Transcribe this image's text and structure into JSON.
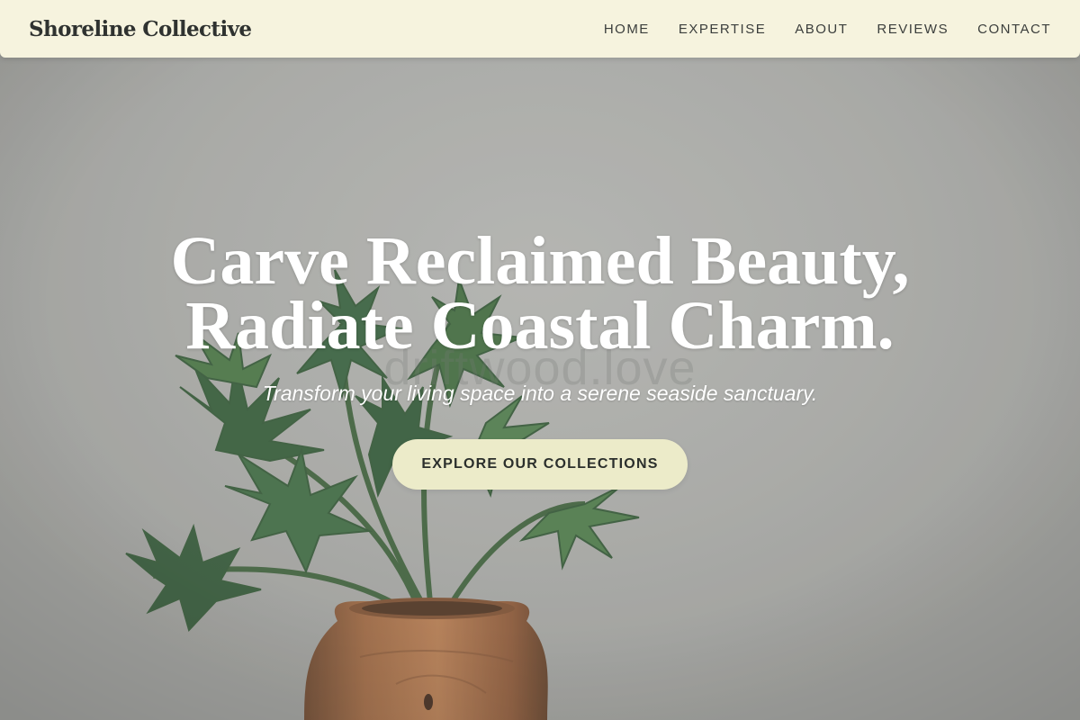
{
  "header": {
    "brand": "Shoreline Collective",
    "nav": [
      {
        "label": "HOME"
      },
      {
        "label": "EXPERTISE"
      },
      {
        "label": "ABOUT"
      },
      {
        "label": "REVIEWS"
      },
      {
        "label": "CONTACT"
      }
    ]
  },
  "hero": {
    "title_line1": "Carve Reclaimed Beauty,",
    "title_line2": "Radiate Coastal Charm.",
    "subtitle": "Transform your living space into a serene seaside sanctuary.",
    "cta_label": "EXPLORE OUR COLLECTIONS",
    "watermark": "driftwood.love",
    "image_subject": "potted-fern-in-wooden-vase"
  },
  "colors": {
    "nav_background": "#f6f3de",
    "cta_background": "#ecebc9",
    "hero_text": "#ffffff",
    "brand_text": "#2f3230"
  }
}
